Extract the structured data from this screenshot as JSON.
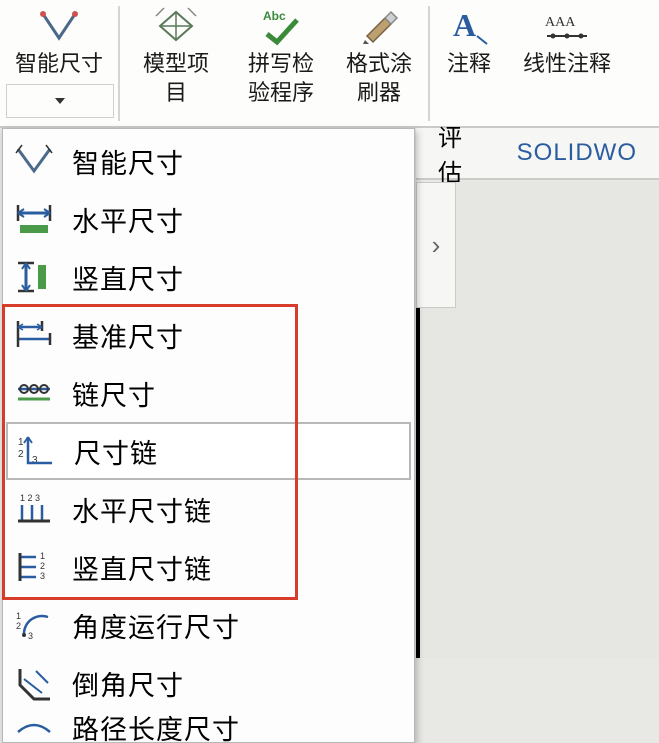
{
  "ribbon": {
    "smart_dim": "智能尺寸",
    "model_items": "模型项\n目",
    "spell_check": "拼写检\n验程序",
    "format_painter": "格式涂\n刷器",
    "annotation": "注释",
    "linear_note": "线性注释"
  },
  "tabs": {
    "evaluate": "评估",
    "solidworks": "SOLIDWO"
  },
  "dropdown": {
    "items": [
      {
        "label": "智能尺寸"
      },
      {
        "label": "水平尺寸"
      },
      {
        "label": "竖直尺寸"
      },
      {
        "label": "基准尺寸"
      },
      {
        "label": "链尺寸"
      },
      {
        "label": "尺寸链"
      },
      {
        "label": "水平尺寸链"
      },
      {
        "label": "竖直尺寸链"
      },
      {
        "label": "角度运行尺寸"
      },
      {
        "label": "倒角尺寸"
      },
      {
        "label": "路径长度尺寸"
      }
    ]
  },
  "panel_expand": "›"
}
